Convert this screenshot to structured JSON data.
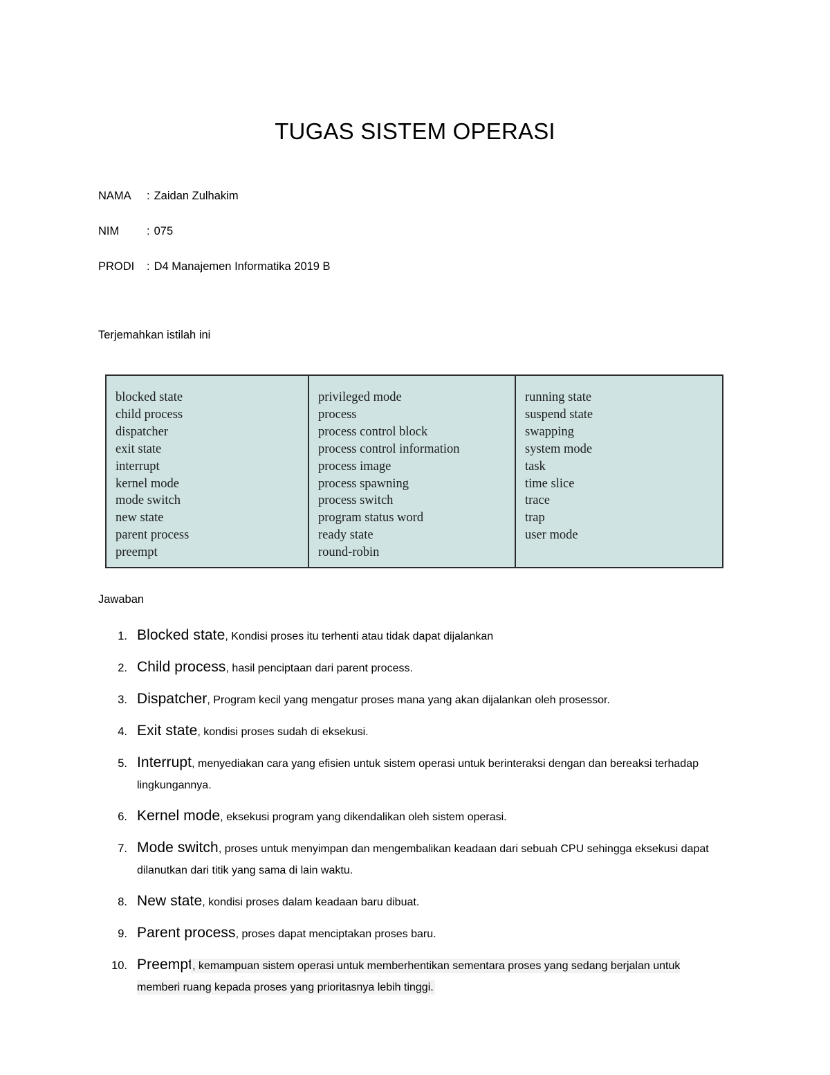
{
  "document": {
    "title": "TUGAS SISTEM OPERASI",
    "meta": [
      {
        "label": "NAMA",
        "sep": ":",
        "value": "Zaidan Zulhakim"
      },
      {
        "label": "NIM",
        "sep": ":",
        "value": "075"
      },
      {
        "label": "PRODI",
        "sep": ":",
        "value": "D4 Manajemen Informatika 2019 B"
      }
    ],
    "instruction": "Terjemahkan istilah ini",
    "answers_label": "Jawaban"
  },
  "terms_table": {
    "background_color": "#cfe3e3",
    "border_color": "#2c2c2c",
    "columns": [
      [
        "blocked state",
        "child process",
        "dispatcher",
        "exit state",
        "interrupt",
        "kernel mode",
        "mode switch",
        "new state",
        "parent process",
        "preempt"
      ],
      [
        "privileged mode",
        "process",
        "process control block",
        "process control information",
        "process image",
        "process spawning",
        "process switch",
        "program status word",
        "ready state",
        "round-robin"
      ],
      [
        "running state",
        "suspend state",
        "swapping",
        "system mode",
        "task",
        "time slice",
        "trace",
        "trap",
        "user mode"
      ]
    ]
  },
  "answers": [
    {
      "num": "1.",
      "term": "Blocked state",
      "desc": ", Kondisi proses itu terhenti atau tidak dapat dijalankan",
      "highlighted": false
    },
    {
      "num": "2.",
      "term": "Child process",
      "desc": ", hasil penciptaan dari parent process.",
      "highlighted": false
    },
    {
      "num": "3.",
      "term": "Dispatcher",
      "desc": ", Program kecil yang mengatur proses mana yang akan dijalankan oleh prosessor.",
      "highlighted": false
    },
    {
      "num": "4.",
      "term": "Exit state",
      "desc": ",  kondisi proses sudah di eksekusi.",
      "highlighted": false
    },
    {
      "num": "5.",
      "term": "Interrupt",
      "desc": ", menyediakan cara yang efisien untuk sistem operasi untuk berinteraksi dengan dan bereaksi terhadap lingkungannya.",
      "highlighted": false
    },
    {
      "num": "6.",
      "term": "Kernel mode",
      "desc": ", eksekusi program yang dikendalikan oleh sistem operasi.",
      "highlighted": false
    },
    {
      "num": "7.",
      "term": "Mode switch",
      "desc": ", proses untuk menyimpan dan mengembalikan keadaan dari sebuah CPU sehingga eksekusi dapat dilanutkan dari titik yang sama di lain waktu.",
      "highlighted": false
    },
    {
      "num": "8.",
      "term": "New state",
      "desc": ", kondisi proses dalam keadaan baru dibuat.",
      "highlighted": false
    },
    {
      "num": "9.",
      "term": "Parent process",
      "desc": ", proses dapat menciptakan proses baru.",
      "highlighted": false
    },
    {
      "num": "10.",
      "term": "Preempt",
      "desc": ", kemampuan sistem operasi untuk memberhentikan sementara proses yang sedang berjalan untuk memberi ruang kepada proses yang prioritasnya lebih tinggi.",
      "highlighted": true
    }
  ]
}
